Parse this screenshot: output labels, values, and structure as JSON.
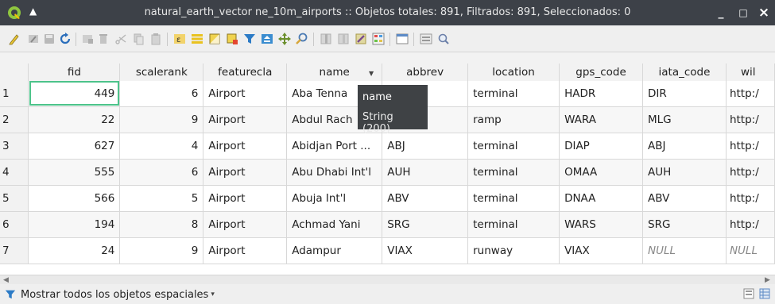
{
  "window": {
    "title": "natural_earth_vector ne_10m_airports :: Objetos totales: 891, Filtrados: 891, Seleccionados: 0",
    "minimize_label": "_",
    "maximize_label": "□",
    "close_label": "×"
  },
  "colors": {
    "titlebar_bg": "#3d4148",
    "focus_outline": "#4cc38a",
    "tooltip_bg": "#3f4245"
  },
  "toolbar": {
    "icons": [
      "toggle-edit-icon",
      "toggle-multiedit-icon",
      "save-edits-icon",
      "reload-icon",
      "add-feature-icon",
      "delete-feature-icon",
      "cut-icon",
      "copy-icon",
      "paste-icon",
      "expression-select-icon",
      "select-all-icon",
      "invert-selection-icon",
      "deselect-all-icon",
      "filter-icon",
      "move-selection-top-icon",
      "pan-to-selected-icon",
      "zoom-to-selected-icon",
      "new-field-icon",
      "delete-field-icon",
      "field-calculator-icon",
      "conditional-format-icon",
      "dock-icon",
      "actions-icon",
      "search-icon"
    ]
  },
  "table": {
    "columns": [
      "fid",
      "scalerank",
      "featurecla",
      "name",
      "abbrev",
      "location",
      "gps_code",
      "iata_code",
      "wil"
    ],
    "sorted_column": "name",
    "rows": [
      {
        "n": "1",
        "fid": "449",
        "scalerank": "6",
        "featurecla": "Airport",
        "name": "Aba Tenna",
        "abbrev": "",
        "location": "terminal",
        "gps_code": "HADR",
        "iata_code": "DIR",
        "wil": "http:/"
      },
      {
        "n": "2",
        "fid": "22",
        "scalerank": "9",
        "featurecla": "Airport",
        "name": "Abdul Rach",
        "abbrev": "",
        "location": "ramp",
        "gps_code": "WARA",
        "iata_code": "MLG",
        "wil": "http:/"
      },
      {
        "n": "3",
        "fid": "627",
        "scalerank": "4",
        "featurecla": "Airport",
        "name": "Abidjan Port ...",
        "abbrev": "ABJ",
        "location": "terminal",
        "gps_code": "DIAP",
        "iata_code": "ABJ",
        "wil": "http:/"
      },
      {
        "n": "4",
        "fid": "555",
        "scalerank": "6",
        "featurecla": "Airport",
        "name": "Abu Dhabi Int'l",
        "abbrev": "AUH",
        "location": "terminal",
        "gps_code": "OMAA",
        "iata_code": "AUH",
        "wil": "http:/"
      },
      {
        "n": "5",
        "fid": "566",
        "scalerank": "5",
        "featurecla": "Airport",
        "name": "Abuja Int'l",
        "abbrev": "ABV",
        "location": "terminal",
        "gps_code": "DNAA",
        "iata_code": "ABV",
        "wil": "http:/"
      },
      {
        "n": "6",
        "fid": "194",
        "scalerank": "8",
        "featurecla": "Airport",
        "name": "Achmad Yani",
        "abbrev": "SRG",
        "location": "terminal",
        "gps_code": "WARS",
        "iata_code": "SRG",
        "wil": "http:/"
      },
      {
        "n": "7",
        "fid": "24",
        "scalerank": "9",
        "featurecla": "Airport",
        "name": "Adampur",
        "abbrev": "VIAX",
        "location": "runway",
        "gps_code": "VIAX",
        "iata_code": "NULL",
        "wil": "NULL"
      }
    ]
  },
  "tooltip": {
    "field_name": "name",
    "field_type": "String (200)"
  },
  "bottom": {
    "filter_label": "Mostrar todos los objetos espaciales"
  }
}
